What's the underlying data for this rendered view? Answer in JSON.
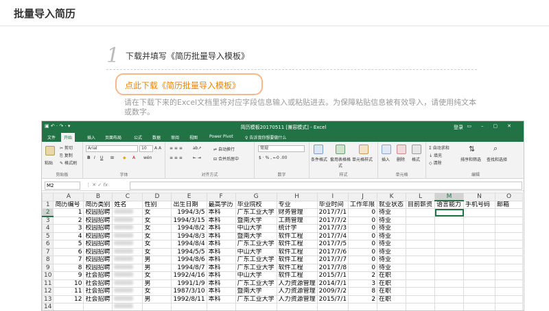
{
  "page": {
    "title": "批量导入简历",
    "step_number": "1",
    "step_title": "下载并填写《简历批量导入模板》",
    "download_link": "点此下载《简历批量导入模板》",
    "hint": "请在下载下来的Excel文档里将对应字段信息输入或粘贴进去。为保障粘贴信息被有效导入，请使用纯文本或数字。"
  },
  "excel": {
    "window_title": "简历模板20170511 [兼容模式] - Excel",
    "login": "登录",
    "tabs": [
      "文件",
      "开始",
      "插入",
      "页面布局",
      "公式",
      "数据",
      "审阅",
      "视图",
      "Power Pivot",
      "告诉我你想要做什么"
    ],
    "ribbon": {
      "paste": "粘贴",
      "cut": "剪切",
      "copy": "复制",
      "format_painter": "格式刷",
      "clipboard": "剪贴板",
      "font_name": "Arial",
      "font_size": "10",
      "font": "字体",
      "wrap_text": "自动换行",
      "merge_center": "合并后居中",
      "alignment": "对齐方式",
      "number_format": "常规",
      "number": "数字",
      "conditional_format": "条件格式",
      "format_table": "套用表格格式",
      "cell_style": "单元格样式",
      "styles": "样式",
      "insert": "插入",
      "delete": "删除",
      "format": "格式",
      "cells": "单元格",
      "autosum": "自动求和",
      "fill": "填充",
      "clear": "清除",
      "sort_filter": "排序和筛选",
      "find_select": "查找和选择",
      "editing": "编辑"
    },
    "name_box": "M2",
    "fx": "fx",
    "columns": [
      "A",
      "B",
      "C",
      "D",
      "E",
      "F",
      "G",
      "H",
      "I",
      "J",
      "K",
      "L",
      "M",
      "N",
      "O"
    ],
    "headers": [
      "简历编号",
      "简历类别",
      "姓名",
      "性别",
      "出生日期",
      "最高学历",
      "毕业院校",
      "专业",
      "毕业时间",
      "工作年限",
      "就业状态",
      "目前薪资",
      "语言能力",
      "手机号码",
      "邮箱"
    ],
    "rows": [
      [
        "1",
        "校园招聘",
        "",
        "女",
        "1994/3/5",
        "本科",
        "广东工业大学",
        "财务管理",
        "2017/7/1",
        "0",
        "待业",
        "",
        "",
        "",
        ""
      ],
      [
        "2",
        "校园招聘",
        "",
        "女",
        "1994/3/15",
        "本科",
        "暨南大学",
        "工商管理",
        "2017/7/2",
        "0",
        "待业",
        "",
        "",
        "",
        ""
      ],
      [
        "3",
        "校园招聘",
        "",
        "女",
        "1994/8/2",
        "本科",
        "中山大学",
        "统计学",
        "2017/7/3",
        "0",
        "待业",
        "",
        "",
        "",
        ""
      ],
      [
        "4",
        "校园招聘",
        "",
        "女",
        "1994/8/3",
        "本科",
        "暨南大学",
        "软件工程",
        "2017/7/4",
        "0",
        "待业",
        "",
        "",
        "",
        ""
      ],
      [
        "5",
        "校园招聘",
        "",
        "女",
        "1994/8/4",
        "本科",
        "广东工业大学",
        "软件工程",
        "2017/7/5",
        "0",
        "待业",
        "",
        "",
        "",
        ""
      ],
      [
        "6",
        "校园招聘",
        "",
        "女",
        "1994/5/5",
        "本科",
        "中山大学",
        "软件工程",
        "2017/7/6",
        "0",
        "待业",
        "",
        "",
        "",
        ""
      ],
      [
        "7",
        "校园招聘",
        "",
        "男",
        "1994/8/6",
        "本科",
        "广东工业大学",
        "软件工程",
        "2017/7/7",
        "0",
        "待业",
        "",
        "",
        "",
        ""
      ],
      [
        "8",
        "校园招聘",
        "",
        "男",
        "1994/8/7",
        "本科",
        "广东工业大学",
        "软件工程",
        "2017/7/8",
        "0",
        "待业",
        "",
        "",
        "",
        ""
      ],
      [
        "9",
        "社会招聘",
        "",
        "女",
        "1992/4/16",
        "本科",
        "中山大学",
        "软件工程",
        "2015/7/1",
        "2",
        "在职",
        "",
        "",
        "",
        ""
      ],
      [
        "10",
        "社会招聘",
        "",
        "男",
        "1991/1/9",
        "本科",
        "广东工业大学",
        "人力资源管理",
        "2014/7/1",
        "3",
        "在职",
        "",
        "",
        "",
        ""
      ],
      [
        "11",
        "社会招聘",
        "",
        "女",
        "1987/3/10",
        "本科",
        "暨南大学",
        "人力资源管理",
        "2009/7/2",
        "8",
        "在职",
        "",
        "",
        "",
        ""
      ],
      [
        "12",
        "社会招聘",
        "",
        "男",
        "1992/8/11",
        "本科",
        "广东工业大学",
        "人力资源管理",
        "2015/7/1",
        "2",
        "在职",
        "",
        "",
        "",
        ""
      ]
    ],
    "colors": {
      "excel_green": "#217346",
      "accent_orange": "#f08300"
    }
  }
}
